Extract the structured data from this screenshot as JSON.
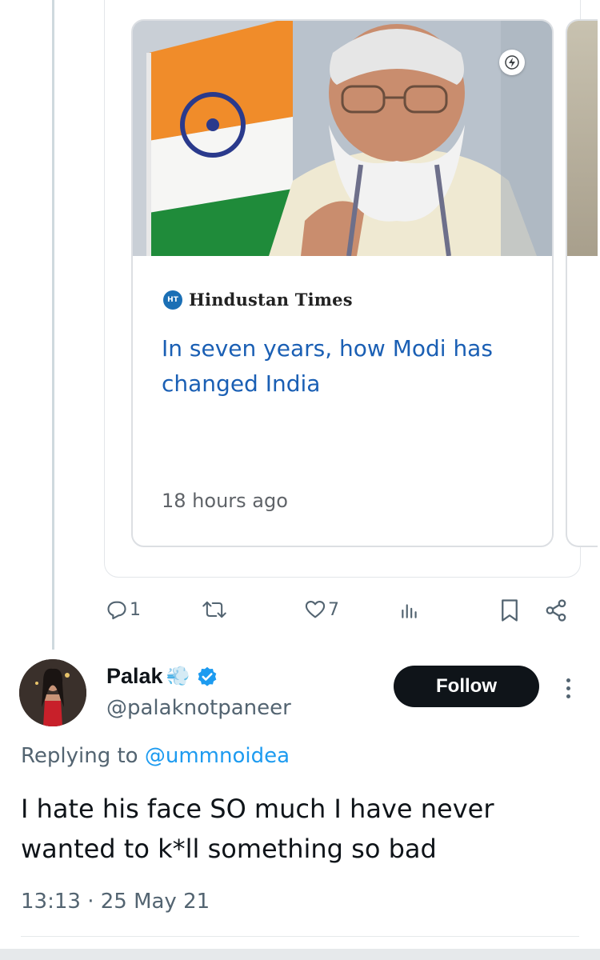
{
  "embedded_card": {
    "source_logo_text": "HT",
    "source_name": "Hindustan Times",
    "headline": "In seven years, how Modi has changed India",
    "time_ago": "18 hours ago",
    "amp_icon": "lightning-bolt-icon"
  },
  "parent_actions": {
    "reply_count": "1",
    "retweet_count": "",
    "like_count": "7"
  },
  "tweet": {
    "display_name": "Palak",
    "name_emoji": "💨",
    "handle": "@palaknotpaneer",
    "follow_label": "Follow",
    "replying_to_prefix": "Replying to",
    "replying_to_handle": "@ummnoidea",
    "text": "I hate his face SO much I have never wanted to k*ll something so bad",
    "timestamp": "13:13 · 25 May 21"
  },
  "colors": {
    "accent_blue": "#1d9bf0",
    "headline_blue": "#1a5fb4",
    "secondary_text": "#536471",
    "follow_bg": "#0f1419"
  }
}
